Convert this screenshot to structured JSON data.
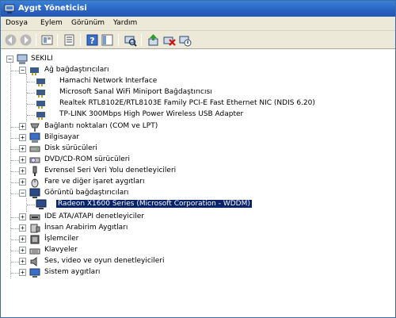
{
  "window": {
    "title": "Aygıt Yöneticisi"
  },
  "menu": [
    "Dosya",
    "Eylem",
    "Görünüm",
    "Yardım"
  ],
  "toolbar": {
    "buttons": [
      "back-icon",
      "forward-icon",
      "up-level-icon",
      "properties-icon",
      "help-icon",
      "show-hide-tree-icon",
      "scan-hardware-icon",
      "update-driver-icon",
      "uninstall-icon",
      "disable-icon"
    ]
  },
  "tree": {
    "root": "SEKILI",
    "categories": [
      {
        "label": "Ağ bağdaştırıcıları",
        "expanded": true,
        "icon": "network-adapter-icon",
        "children": [
          "Hamachi Network Interface",
          "Microsoft Sanal WiFi Miniport Bağdaştırıcısı",
          "Realtek RTL8102E/RTL8103E Family PCI-E Fast Ethernet NIC (NDIS 6.20)",
          "TP-LINK 300Mbps High Power Wireless USB Adapter"
        ]
      },
      {
        "label": "Bağlantı noktaları (COM ve LPT)",
        "expanded": false,
        "icon": "port-icon"
      },
      {
        "label": "Bilgisayar",
        "expanded": false,
        "icon": "computer-icon"
      },
      {
        "label": "Disk sürücüleri",
        "expanded": false,
        "icon": "disk-drive-icon"
      },
      {
        "label": "DVD/CD-ROM sürücüleri",
        "expanded": false,
        "icon": "dvd-drive-icon"
      },
      {
        "label": "Evrensel Seri Veri Yolu denetleyicileri",
        "expanded": false,
        "icon": "usb-icon"
      },
      {
        "label": "Fare ve diğer işaret aygıtları",
        "expanded": false,
        "icon": "mouse-icon"
      },
      {
        "label": "Görüntü bağdaştırıcıları",
        "expanded": true,
        "icon": "display-adapter-icon",
        "children": [
          "Radeon X1600 Series (Microsoft Corporation - WDDM)"
        ]
      },
      {
        "label": "IDE ATA/ATAPI denetleyiciler",
        "expanded": false,
        "icon": "ide-controller-icon"
      },
      {
        "label": "İnsan Arabirim Aygıtları",
        "expanded": false,
        "icon": "hid-icon"
      },
      {
        "label": "İşlemciler",
        "expanded": false,
        "icon": "processor-icon"
      },
      {
        "label": "Klavyeler",
        "expanded": false,
        "icon": "keyboard-icon"
      },
      {
        "label": "Ses, video ve oyun denetleyicileri",
        "expanded": false,
        "icon": "sound-icon"
      },
      {
        "label": "Sistem aygıtları",
        "expanded": false,
        "icon": "system-device-icon"
      }
    ]
  },
  "selected": "Radeon X1600 Series (Microsoft Corporation - WDDM)",
  "colors": {
    "title_bar": "#2a62c2",
    "selection": "#0a246a",
    "chrome": "#ece9d8"
  }
}
